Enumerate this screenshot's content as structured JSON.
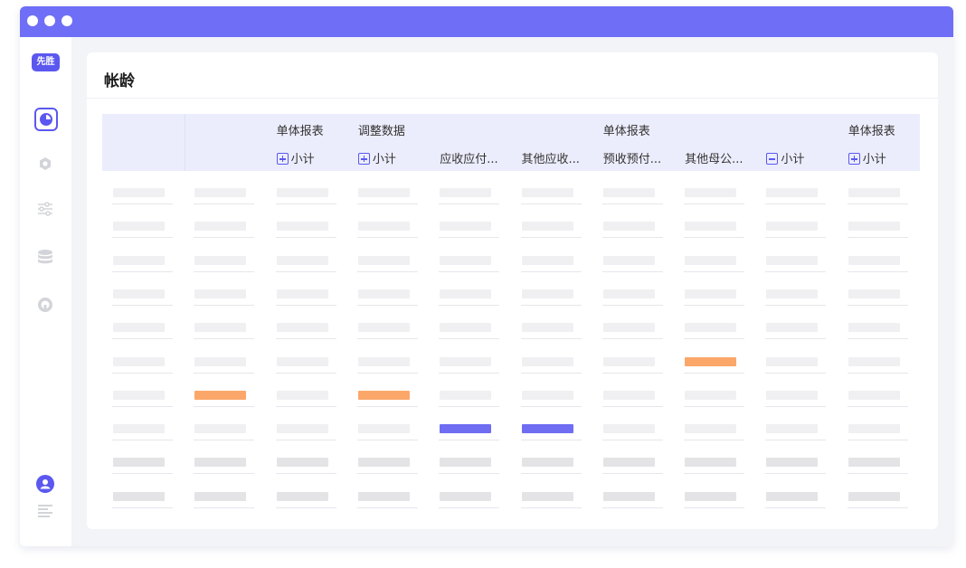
{
  "app": {
    "logo_text": "先胜"
  },
  "page": {
    "title": "帐龄"
  },
  "sidebar": {
    "items": [
      {
        "icon": "pie-chart-icon",
        "active": true
      },
      {
        "icon": "gear-icon",
        "active": false
      },
      {
        "icon": "sliders-icon",
        "active": false
      },
      {
        "icon": "database-icon",
        "active": false
      },
      {
        "icon": "headset-icon",
        "active": false
      }
    ],
    "bottom": [
      {
        "icon": "user-icon"
      },
      {
        "icon": "document-lines-icon"
      }
    ]
  },
  "table": {
    "group_headers": [
      "",
      "",
      "单体报表",
      "调整数据",
      "",
      "",
      "单体报表",
      "",
      "",
      "单体报表"
    ],
    "sub_headers": [
      {
        "label": "",
        "toggle": null
      },
      {
        "label": "",
        "toggle": null
      },
      {
        "label": "小计",
        "toggle": "plus"
      },
      {
        "label": "小计",
        "toggle": "plus"
      },
      {
        "label": "应收应付...",
        "toggle": null
      },
      {
        "label": "其他应收...",
        "toggle": null
      },
      {
        "label": "预收预付...",
        "toggle": null
      },
      {
        "label": "其他母公...",
        "toggle": null
      },
      {
        "label": "小计",
        "toggle": "minus"
      },
      {
        "label": "小计",
        "toggle": "plus"
      }
    ],
    "row_count": 10,
    "column_count": 10,
    "highlights": [
      {
        "row": 6,
        "col": 1,
        "color": "#fba76a"
      },
      {
        "row": 6,
        "col": 3,
        "color": "#fba76a"
      },
      {
        "row": 5,
        "col": 7,
        "color": "#fba76a"
      },
      {
        "row": 7,
        "col": 4,
        "color": "#6f6df2"
      },
      {
        "row": 7,
        "col": 5,
        "color": "#6f6df2"
      }
    ]
  },
  "colors": {
    "accent": "#5b58f0",
    "titlebar": "#6e6ef7",
    "header_bg": "#ecedfc",
    "placeholder_light": "#f0f0f2",
    "placeholder_dark": "#e4e4e7",
    "highlight_orange": "#fba76a",
    "highlight_blue": "#6f6df2"
  }
}
